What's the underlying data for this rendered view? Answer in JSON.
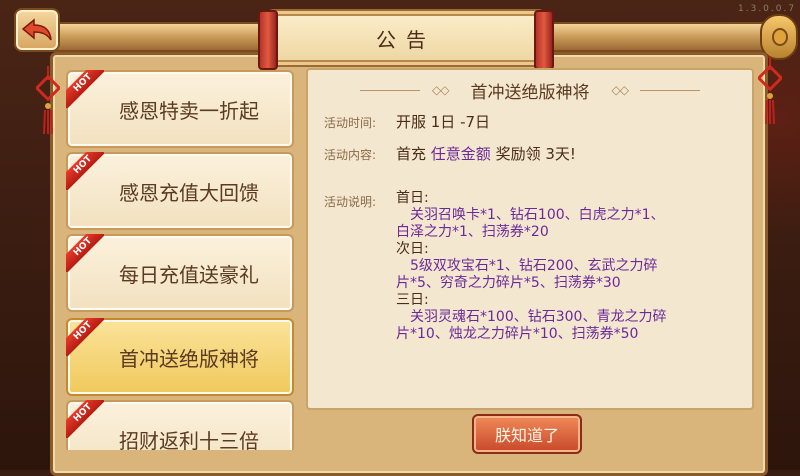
{
  "version": "1.3.0.0.7",
  "title": "公告",
  "back_icon": "back-arrow-icon",
  "hot_label": "HOT",
  "events": [
    {
      "label": "感恩特卖一折起",
      "hot": true,
      "selected": false
    },
    {
      "label": "感恩充值大回馈",
      "hot": true,
      "selected": false
    },
    {
      "label": "每日充值送豪礼",
      "hot": true,
      "selected": false
    },
    {
      "label": "首冲送绝版神将",
      "hot": true,
      "selected": true
    },
    {
      "label": "招财返利十三倍",
      "hot": true,
      "selected": false
    }
  ],
  "detail": {
    "heading": "首冲送绝版神将",
    "time_label": "活动时间:",
    "time_value": "开服 1日 -7日",
    "content_label": "活动内容:",
    "content_prefix": "首充",
    "content_highlight": "任意金额",
    "content_suffix": "奖励领 3天!",
    "desc_label": "活动说明:",
    "days": [
      {
        "day": "首日:",
        "reward_line1": "关羽召唤卡*1、钻石100、白虎之力*1、",
        "reward_line2": "白泽之力*1、扫荡券*20"
      },
      {
        "day": "次日:",
        "reward_line1": "5级双攻宝石*1、钻石200、玄武之力碎",
        "reward_line2": "片*5、穷奇之力碎片*5、扫荡券*30"
      },
      {
        "day": "三日:",
        "reward_line1": "关羽灵魂石*100、钻石300、青龙之力碎",
        "reward_line2": "片*10、烛龙之力碎片*10、扫荡券*50"
      }
    ]
  },
  "confirm_label": "朕知道了",
  "colors": {
    "selected_item": "#f0c95c",
    "reward_text": "#6a2a9a",
    "confirm_button": "#c8482a"
  }
}
